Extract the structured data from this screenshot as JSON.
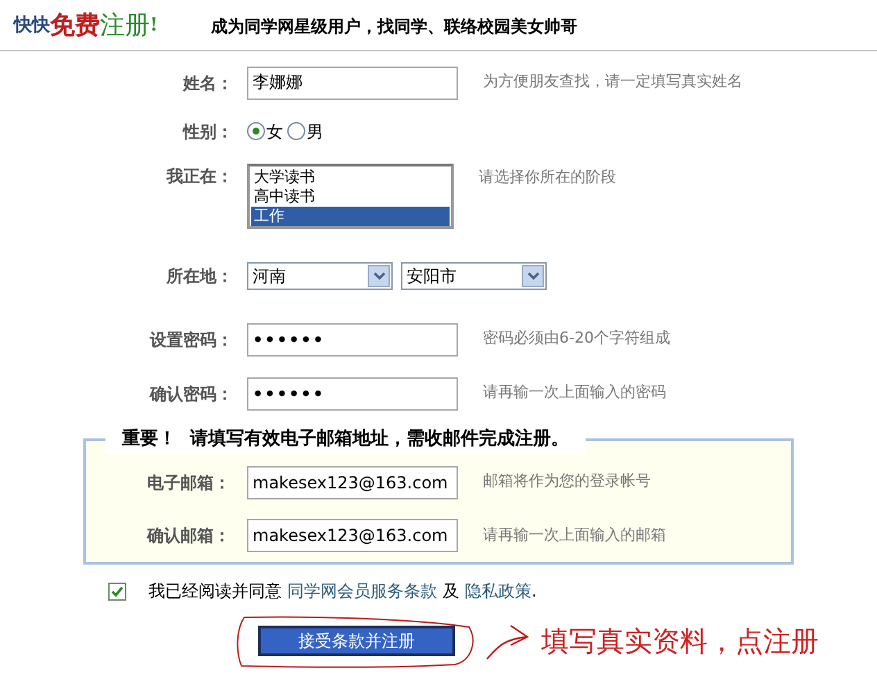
{
  "header": {
    "prefix": "快快",
    "free": "免费",
    "register": "注册",
    "exclaim": "!",
    "slogan": "成为同学网星级用户，找同学、联络校园美女帅哥"
  },
  "fields": [
    {
      "kind": "text",
      "label": "姓名：",
      "value": "李娜娜",
      "hint": "为方便朋友查找，请一定填写真实姓名"
    },
    {
      "kind": "radio",
      "label": "性别：",
      "options": [
        {
          "label": "女",
          "selected": true
        },
        {
          "label": "男",
          "selected": false
        }
      ]
    },
    {
      "kind": "listbox",
      "label": "我正在：",
      "options": [
        {
          "label": "大学读书",
          "selected": false
        },
        {
          "label": "高中读书",
          "selected": false
        },
        {
          "label": "工作",
          "selected": true
        }
      ],
      "hint": "请选择你所在的阶段"
    },
    {
      "kind": "selects",
      "label": "所在地：",
      "values": [
        "河南",
        "安阳市"
      ]
    },
    {
      "kind": "password",
      "label": "设置密码：",
      "value": "••••••",
      "hint": "密码必须由6-20个字符组成"
    },
    {
      "kind": "password",
      "label": "确认密码：",
      "value": "••••••",
      "hint": "请再输一次上面输入的密码"
    }
  ],
  "email_box": {
    "legend_strong": "重要！",
    "legend": "请填写有效电子邮箱地址，需收邮件完成注册。",
    "fields": [
      {
        "label": "电子邮箱：",
        "value": "makesex123@163.com",
        "hint": "邮箱将作为您的登录帐号"
      },
      {
        "label": "确认邮箱：",
        "value": "makesex123@163.com",
        "hint": "请再输一次上面输入的邮箱"
      }
    ]
  },
  "agreement": {
    "checked": true,
    "text": "我已经阅读并同意",
    "terms_link": "同学网会员服务条款",
    "and": "及",
    "privacy_link": "隐私政策",
    "period": "."
  },
  "submit": "接受条款并注册",
  "annotation": "填写真实资料，点注册"
}
